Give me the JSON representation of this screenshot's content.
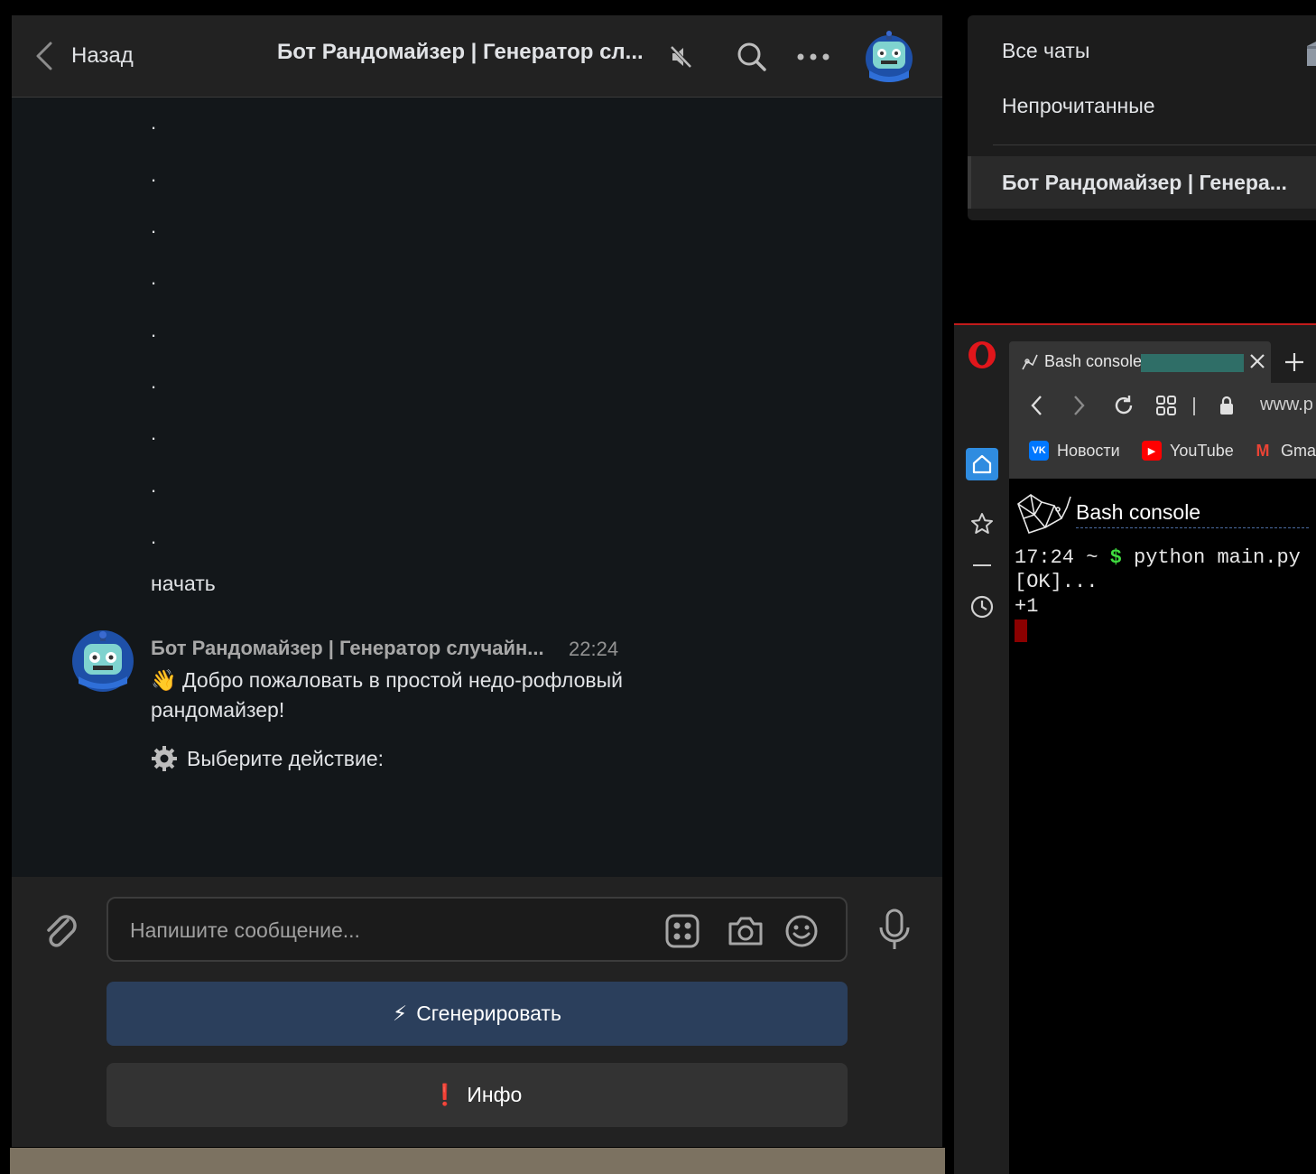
{
  "chat": {
    "back_label": "Назад",
    "title": "Бот Рандомайзер | Генератор сл...",
    "dot_messages": [
      ".",
      ".",
      ".",
      ".",
      ".",
      ".",
      ".",
      ".",
      "."
    ],
    "start_message": "начать",
    "bot_name": "Бот Рандомайзер | Генератор случайн...",
    "bot_time": "22:24",
    "bot_text1": "👋 Добро пожаловать в простой недо-рофловый рандомайзер!",
    "bot_text2": "Выберите действие:",
    "input_placeholder": "Напишите сообщение...",
    "buttons": {
      "generate": "Сгенерировать",
      "generate_emoji": "⚡",
      "info": "Инфо",
      "info_emoji": "❗"
    }
  },
  "chatlist": {
    "folder_all": "Все чаты",
    "folder_unread": "Непрочитанные",
    "active_chat": "Бот Рандомайзер | Генера..."
  },
  "browser": {
    "tab_title": "Bash console",
    "url": "www.p",
    "bookmarks": [
      {
        "label": "Новости",
        "icon": "vk-icon",
        "badge": "VK",
        "color": "#0077ff"
      },
      {
        "label": "YouTube",
        "icon": "youtube-icon",
        "badge": "▶",
        "color": "#ff0000"
      },
      {
        "label": "Gma",
        "icon": "gmail-icon",
        "badge": "M",
        "color": "#ea4335"
      }
    ],
    "console_title": "Bash console",
    "terminal": {
      "prompt_time": "17:24 ~ ",
      "prompt_symbol": "$",
      "command": " python main.py",
      "line2": "[OK]...",
      "line3": "+1"
    }
  },
  "colors": {
    "accent_button": "#2b3f5c",
    "opera_red": "#c21b1b",
    "prompt_green": "#3fdc3f",
    "cursor_red": "#8b0000"
  }
}
